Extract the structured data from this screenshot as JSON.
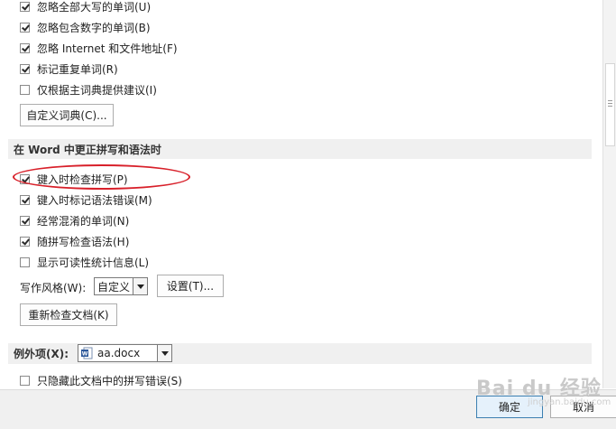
{
  "proofing": {
    "options_top": [
      {
        "label": "忽略全部大写的单词(U)",
        "checked": true
      },
      {
        "label": "忽略包含数字的单词(B)",
        "checked": true
      },
      {
        "label": "忽略 Internet 和文件地址(F)",
        "checked": true
      },
      {
        "label": "标记重复单词(R)",
        "checked": true
      },
      {
        "label": "仅根据主词典提供建议(I)",
        "checked": false
      }
    ],
    "custom_dict_button": "自定义词典(C)...",
    "word_section_title": "在 Word 中更正拼写和语法时",
    "options_word": [
      {
        "label": "键入时检查拼写(P)",
        "checked": true
      },
      {
        "label": "键入时标记语法错误(M)",
        "checked": true
      },
      {
        "label": "经常混淆的单词(N)",
        "checked": true
      },
      {
        "label": "随拼写检查语法(H)",
        "checked": true
      },
      {
        "label": "显示可读性统计信息(L)",
        "checked": false
      }
    ],
    "writing_style_label": "写作风格(W):",
    "writing_style_value": "自定义",
    "settings_button": "设置(T)...",
    "recheck_button": "重新检查文档(K)",
    "exceptions_label": "例外项(X):",
    "exceptions_file": "aa.docx",
    "exceptions_options": [
      {
        "label": "只隐藏此文档中的拼写错误(S)",
        "checked": false
      }
    ]
  },
  "footer": {
    "ok_button": "确定",
    "cancel_button": "取消"
  },
  "watermark": {
    "text": "Bai du 经验",
    "sub": "jingyan.baidu.com"
  },
  "colors": {
    "highlight_oval": "#d8202a",
    "section_bg": "#f0f0f0",
    "word_icon": "#2b579a"
  }
}
